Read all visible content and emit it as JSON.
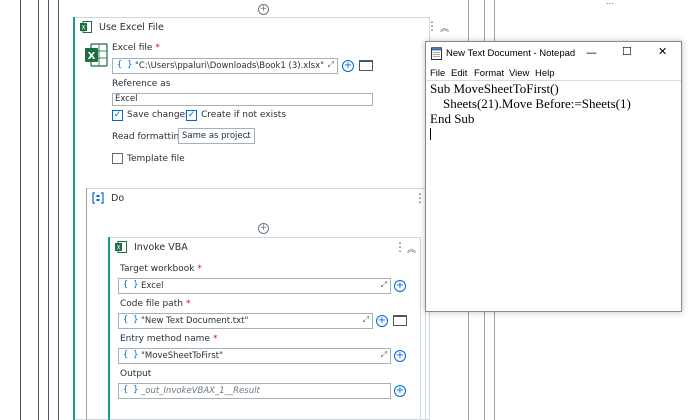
{
  "top_right_partial": "...",
  "use_excel": {
    "title": "Use Excel File",
    "excel_file_label": "Excel file",
    "excel_file_value": "\"C:\\Users\\ppaluri\\Downloads\\Book1 (3).xlsx\"",
    "reference_label": "Reference as",
    "reference_value": "Excel",
    "save_changes_label": "Save changes",
    "create_if_not_exists_label": "Create if not exists",
    "read_formatting_label": "Read formatting",
    "read_formatting_value": "Same as project",
    "template_file_label": "Template file"
  },
  "do_block": {
    "title": "Do"
  },
  "invoke_vba": {
    "title": "Invoke VBA",
    "target_workbook_label": "Target workbook",
    "target_workbook_value": "Excel",
    "code_file_label": "Code file path",
    "code_file_value": "\"New Text Document.txt\"",
    "entry_method_label": "Entry method name",
    "entry_method_value": "\"MoveSheetToFirst\"",
    "output_label": "Output",
    "output_value": "_out_InvokeVBAX_1__Result"
  },
  "required_mark": "*",
  "brace_glyph": "{ }",
  "notepad": {
    "title": "New Text Document - Notepad",
    "menu": [
      "File",
      "Edit",
      "Format",
      "View",
      "Help"
    ],
    "lines": [
      "Sub MoveSheetToFirst()",
      "    Sheets(21).Move Before:=Sheets(1)",
      "End Sub"
    ]
  },
  "colors": {
    "accent": "#0067df",
    "teal": "#1a9a8f",
    "excel_green": "#1d6f42"
  }
}
